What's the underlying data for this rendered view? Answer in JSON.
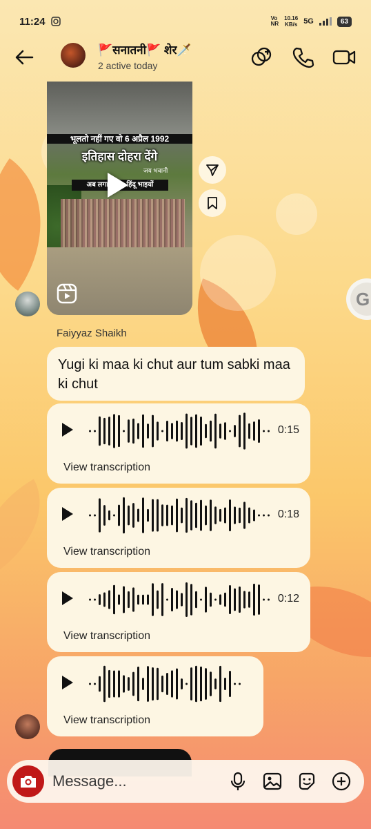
{
  "status_bar": {
    "time": "11:24",
    "network_speed_line1": "10.16",
    "network_speed_line2": "KB/s",
    "network_type": "5G",
    "battery": "63"
  },
  "header": {
    "title": "🚩सनातनी🚩 शेर🗡️",
    "subtitle": "2 active today"
  },
  "video_message": {
    "line1": "भूलतो नहीं गए वो 6 अप्रैल 1992",
    "line2": "इतिहास दोहरा देंगे",
    "small_text": "जय भवानी",
    "line3": "अब लगाओ..... हिंदू भाइयों"
  },
  "sender_name": "Faiyyaz Shaikh",
  "text_message": "Yugi ki maa ki chut aur tum sabki maa ki chut",
  "voice_messages": [
    {
      "duration": "0:15",
      "action": "View transcription"
    },
    {
      "duration": "0:18",
      "action": "View transcription"
    },
    {
      "duration": "0:12",
      "action": "View transcription"
    },
    {
      "duration": "",
      "action": "View transcription"
    }
  ],
  "composer": {
    "placeholder": "Message..."
  },
  "colors": {
    "camera_button": "#c01818",
    "bubble": "#fdf6e3"
  }
}
